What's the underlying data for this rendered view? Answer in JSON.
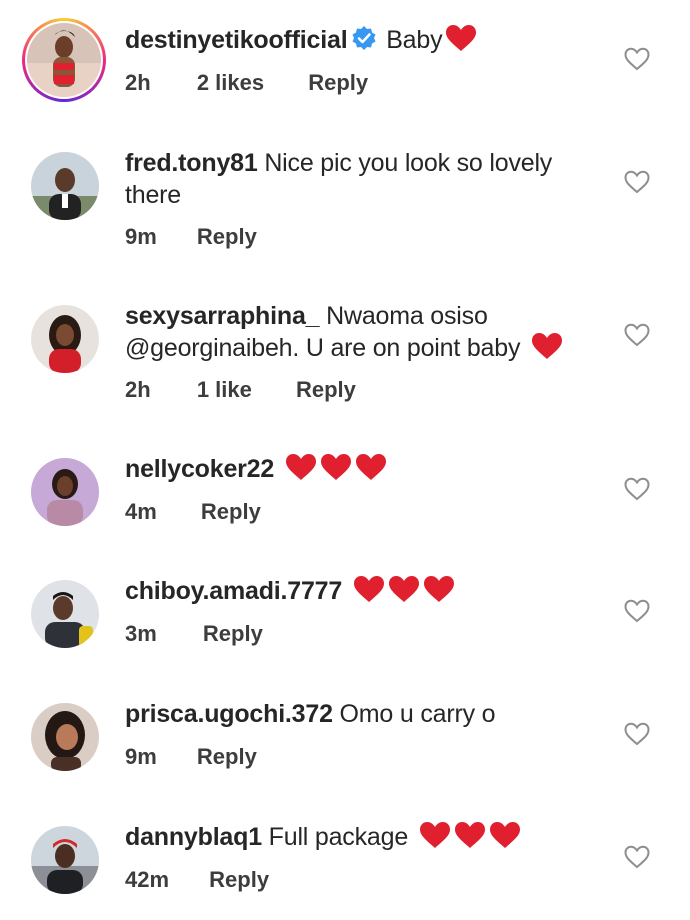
{
  "comments": [
    {
      "username": "destinyetikoofficial",
      "verified": true,
      "text": "Baby",
      "hearts": 1,
      "time": "2h",
      "likes": "2 likes",
      "reply": "Reply",
      "story_ring": true
    },
    {
      "username": "fred.tony81",
      "text": "Nice pic you look so lovely there",
      "hearts": 0,
      "time": "9m",
      "likes": "",
      "reply": "Reply"
    },
    {
      "username": "sexysarraphina_",
      "text": "Nwaoma osiso @georginaibeh. U are on point baby",
      "hearts": 1,
      "time": "2h",
      "likes": "1 like",
      "reply": "Reply"
    },
    {
      "username": "nellycoker22",
      "text": "",
      "hearts": 3,
      "time": "4m",
      "likes": "",
      "reply": "Reply"
    },
    {
      "username": "chiboy.amadi.7777",
      "text": "",
      "hearts": 3,
      "time": "3m",
      "likes": "",
      "reply": "Reply"
    },
    {
      "username": "prisca.ugochi.372",
      "text": "Omo u carry o",
      "hearts": 0,
      "time": "9m",
      "likes": "",
      "reply": "Reply"
    },
    {
      "username": "dannyblaq1",
      "text": "Full package",
      "hearts": 3,
      "time": "42m",
      "likes": "",
      "reply": "Reply"
    }
  ],
  "colors": {
    "heart_emoji": "#e0202e",
    "verified_badge": "#3897f0",
    "text": "#262626",
    "meta": "#3d3d3d",
    "like_outline": "#8e8e8e"
  },
  "icons": {
    "verified": "verified-badge-icon",
    "like": "heart-outline-icon",
    "emoji": "red-heart-emoji"
  }
}
